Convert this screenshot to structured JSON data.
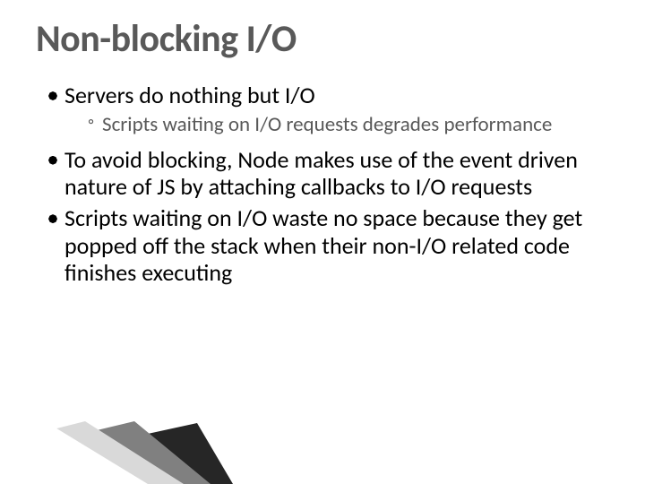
{
  "title": "Non-blocking I/O",
  "bullets": {
    "b0": {
      "text": "Servers do nothing but I/O",
      "sub0": "Scripts waiting on I/O requests degrades performance"
    },
    "b1": {
      "text": "To avoid blocking, Node makes use of the event driven nature of JS by attaching callbacks to I/O requests"
    },
    "b2": {
      "text": "Scripts waiting on I/O waste no space because they get popped off the stack when their non-I/O related code finishes executing"
    }
  }
}
